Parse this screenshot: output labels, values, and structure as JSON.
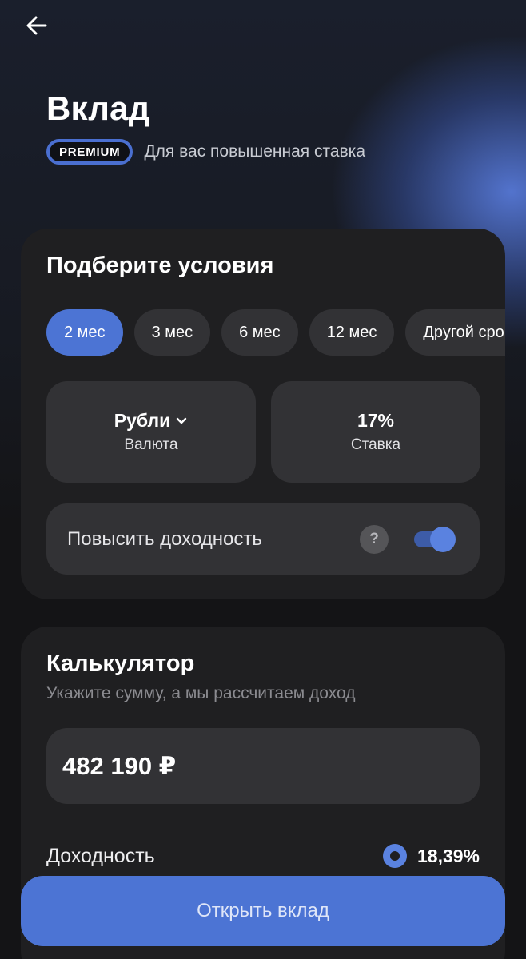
{
  "header": {
    "title": "Вклад",
    "badge": "PREMIUM",
    "badge_text": "Для вас повышенная ставка"
  },
  "conditions": {
    "title": "Подберите условия",
    "terms": [
      "2 мес",
      "3 мес",
      "6 мес",
      "12 мес",
      "Другой срок"
    ],
    "selected_term_index": 0,
    "currency": {
      "value": "Рубли",
      "label": "Валюта"
    },
    "rate": {
      "value": "17%",
      "label": "Ставка"
    },
    "boost": {
      "label": "Повысить доходность",
      "help": "?",
      "enabled": true
    }
  },
  "calculator": {
    "title": "Калькулятор",
    "subtitle": "Укажите сумму, а мы рассчитаем доход",
    "amount": "482 190 ₽",
    "yield_label": "Доходность",
    "yield_value": "18,39%"
  },
  "cta": {
    "label": "Открыть вклад"
  },
  "colors": {
    "accent": "#4c74d4",
    "card": "#1f1f21",
    "tile": "#323235"
  },
  "icons": {
    "back": "arrow-left-icon",
    "dropdown": "chevron-down-icon"
  }
}
